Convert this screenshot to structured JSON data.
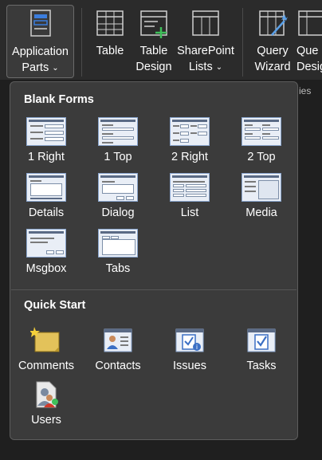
{
  "ribbon": {
    "buttons": [
      {
        "key": "application-parts",
        "line1": "Application",
        "line2": "Parts",
        "dropdown": true
      },
      {
        "key": "table",
        "line1": "Table",
        "line2": "",
        "dropdown": false
      },
      {
        "key": "table-design",
        "line1": "Table",
        "line2": "Design",
        "dropdown": false
      },
      {
        "key": "sharepoint-lists",
        "line1": "SharePoint",
        "line2": "Lists",
        "dropdown": true
      },
      {
        "key": "query-wizard",
        "line1": "Query",
        "line2": "Wizard",
        "dropdown": false
      },
      {
        "key": "query-design",
        "line1": "Que",
        "line2": "Desig",
        "dropdown": false
      }
    ],
    "chevron": "⌄",
    "group_label_fragment": "ies"
  },
  "menu": {
    "blank_forms": {
      "title": "Blank Forms",
      "items": [
        "1 Right",
        "1 Top",
        "2 Right",
        "2 Top",
        "Details",
        "Dialog",
        "List",
        "Media",
        "Msgbox",
        "Tabs"
      ]
    },
    "quick_start": {
      "title": "Quick Start",
      "items": [
        "Comments",
        "Contacts",
        "Issues",
        "Tasks",
        "Users"
      ]
    }
  },
  "colors": {
    "accent_green": "#3fbf5a",
    "form_blue": "#8aa6cf",
    "ribbon_bg": "#2b2b2b",
    "menu_bg": "#3b3b3b"
  }
}
